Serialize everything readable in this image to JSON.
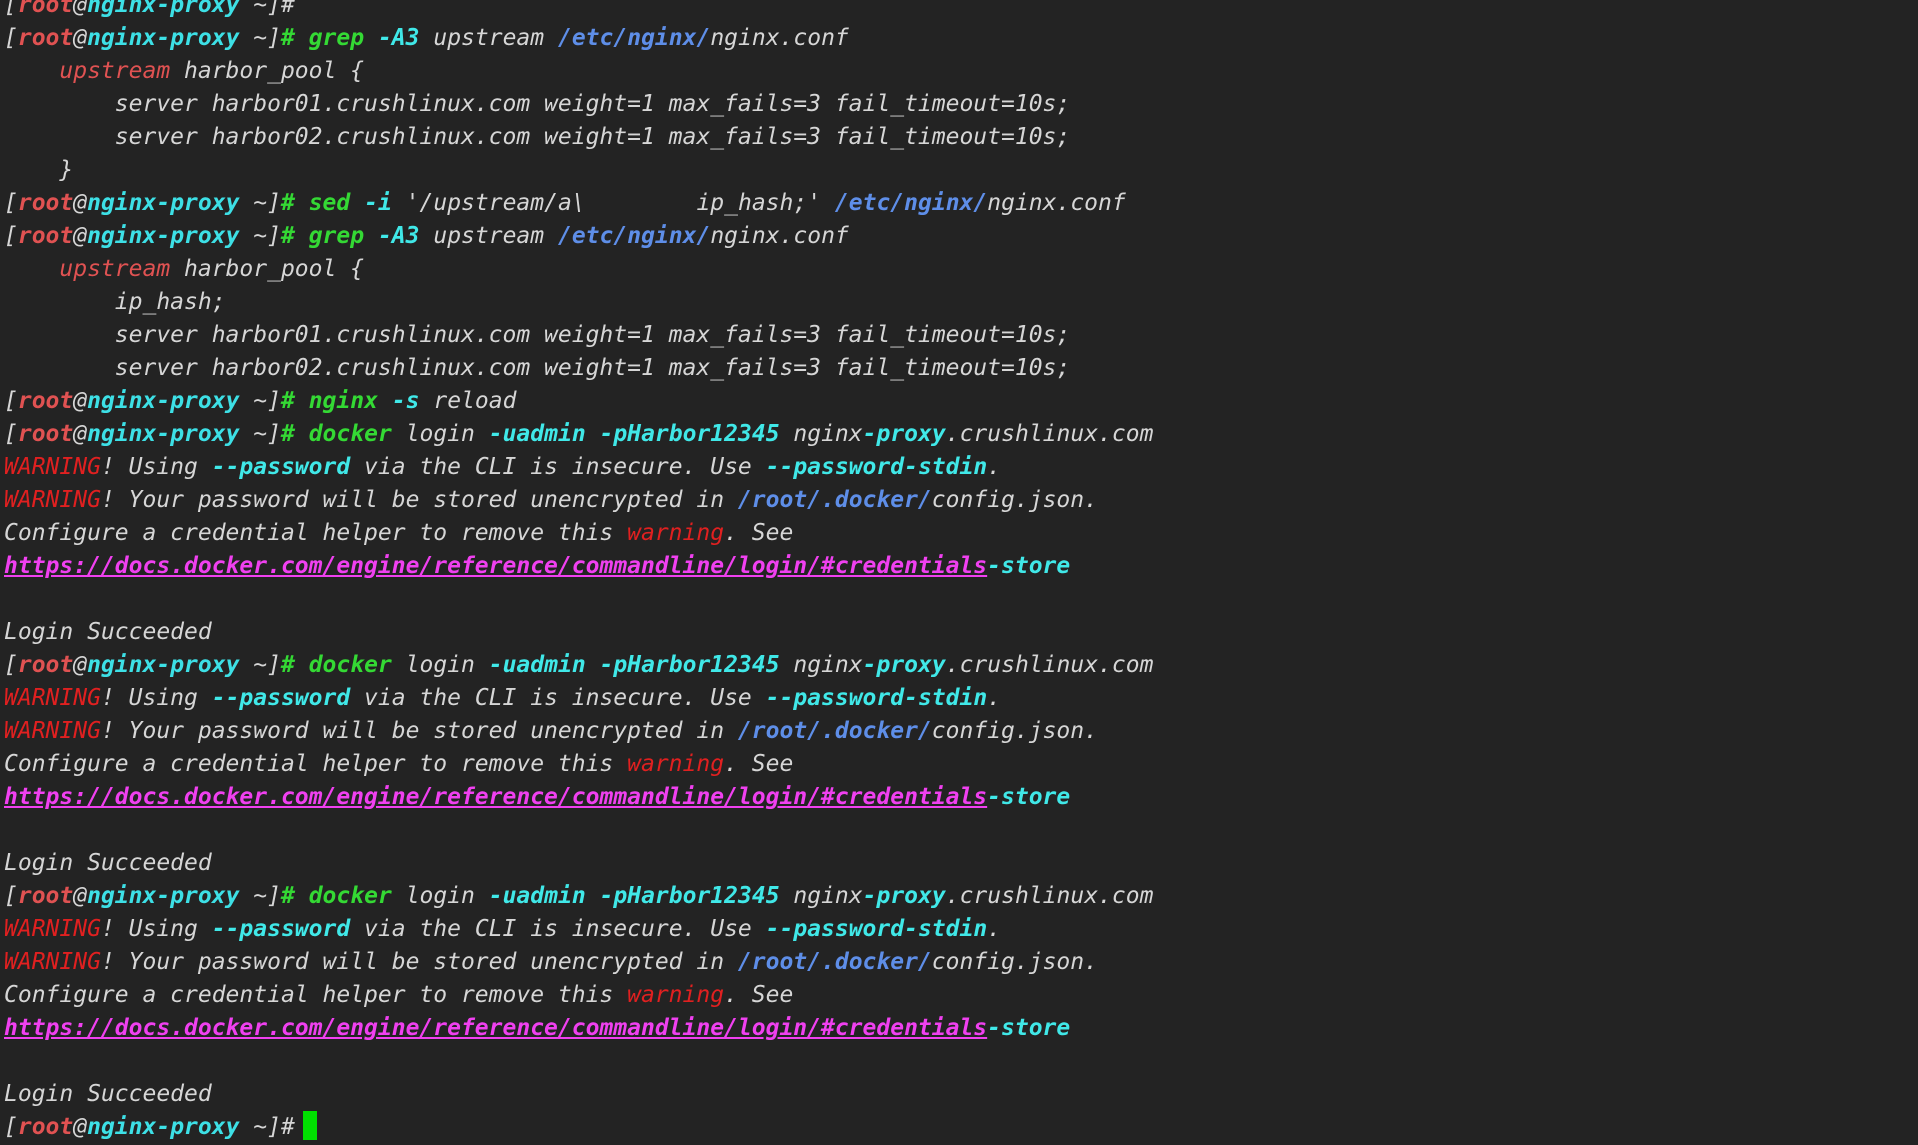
{
  "window": {
    "title": "",
    "background": "#232323"
  },
  "palette": {
    "default": "#d6d6d6",
    "bracket": "#d6d6d6",
    "user": "#e05252",
    "host": "#3de0e6",
    "path": "#5e8ee8",
    "command": "#34d934",
    "option": "#40e8e8",
    "keyword": "#e05252",
    "warning": "#e02020",
    "link": "#f040f0",
    "url_tail": "#40e8e8"
  },
  "terminal": {
    "lines": [
      [
        {
          "t": "[",
          "c": "default"
        },
        {
          "t": "root",
          "c": "user"
        },
        {
          "t": "@",
          "c": "default"
        },
        {
          "t": "nginx",
          "c": "host"
        },
        {
          "t": "-proxy",
          "c": "host"
        },
        {
          "t": " ~]",
          "c": "default"
        },
        {
          "t": "#",
          "c": "default"
        }
      ],
      [
        {
          "t": "[",
          "c": "default"
        },
        {
          "t": "root",
          "c": "user"
        },
        {
          "t": "@",
          "c": "default"
        },
        {
          "t": "nginx",
          "c": "host"
        },
        {
          "t": "-proxy",
          "c": "host"
        },
        {
          "t": " ~]",
          "c": "default"
        },
        {
          "t": "# ",
          "c": "command"
        },
        {
          "t": "grep",
          "c": "command"
        },
        {
          "t": " ",
          "c": "default"
        },
        {
          "t": "-A3",
          "c": "option"
        },
        {
          "t": " upstream ",
          "c": "default"
        },
        {
          "t": "/etc/nginx/",
          "c": "path"
        },
        {
          "t": "nginx.conf",
          "c": "default"
        }
      ],
      [
        {
          "t": "    ",
          "c": "default"
        },
        {
          "t": "upstream",
          "c": "keyword"
        },
        {
          "t": " harbor_pool {",
          "c": "default"
        }
      ],
      [
        {
          "t": "        server harbor01.crushlinux.com weight=1 max_fails=3 fail_timeout=10s;",
          "c": "default"
        }
      ],
      [
        {
          "t": "        server harbor02.crushlinux.com weight=1 max_fails=3 fail_timeout=10s;",
          "c": "default"
        }
      ],
      [
        {
          "t": "    }",
          "c": "default"
        }
      ],
      [
        {
          "t": "[",
          "c": "default"
        },
        {
          "t": "root",
          "c": "user"
        },
        {
          "t": "@",
          "c": "default"
        },
        {
          "t": "nginx",
          "c": "host"
        },
        {
          "t": "-proxy",
          "c": "host"
        },
        {
          "t": " ~]",
          "c": "default"
        },
        {
          "t": "# ",
          "c": "command"
        },
        {
          "t": "sed",
          "c": "command"
        },
        {
          "t": " ",
          "c": "default"
        },
        {
          "t": "-i",
          "c": "option"
        },
        {
          "t": " '/upstream/a\\        ip_hash;' ",
          "c": "default"
        },
        {
          "t": "/etc/nginx/",
          "c": "path"
        },
        {
          "t": "nginx.conf",
          "c": "default"
        }
      ],
      [
        {
          "t": "[",
          "c": "default"
        },
        {
          "t": "root",
          "c": "user"
        },
        {
          "t": "@",
          "c": "default"
        },
        {
          "t": "nginx",
          "c": "host"
        },
        {
          "t": "-proxy",
          "c": "host"
        },
        {
          "t": " ~]",
          "c": "default"
        },
        {
          "t": "# ",
          "c": "command"
        },
        {
          "t": "grep",
          "c": "command"
        },
        {
          "t": " ",
          "c": "default"
        },
        {
          "t": "-A3",
          "c": "option"
        },
        {
          "t": " upstream ",
          "c": "default"
        },
        {
          "t": "/etc/nginx/",
          "c": "path"
        },
        {
          "t": "nginx.conf",
          "c": "default"
        }
      ],
      [
        {
          "t": "    ",
          "c": "default"
        },
        {
          "t": "upstream",
          "c": "keyword"
        },
        {
          "t": " harbor_pool {",
          "c": "default"
        }
      ],
      [
        {
          "t": "        ip_hash;",
          "c": "default"
        }
      ],
      [
        {
          "t": "        server harbor01.crushlinux.com weight=1 max_fails=3 fail_timeout=10s;",
          "c": "default"
        }
      ],
      [
        {
          "t": "        server harbor02.crushlinux.com weight=1 max_fails=3 fail_timeout=10s;",
          "c": "default"
        }
      ],
      [
        {
          "t": "[",
          "c": "default"
        },
        {
          "t": "root",
          "c": "user"
        },
        {
          "t": "@",
          "c": "default"
        },
        {
          "t": "nginx",
          "c": "host"
        },
        {
          "t": "-proxy",
          "c": "host"
        },
        {
          "t": " ~]",
          "c": "default"
        },
        {
          "t": "# ",
          "c": "command"
        },
        {
          "t": "nginx",
          "c": "command"
        },
        {
          "t": " ",
          "c": "default"
        },
        {
          "t": "-s",
          "c": "option"
        },
        {
          "t": " reload",
          "c": "default"
        }
      ],
      [
        {
          "t": "[",
          "c": "default"
        },
        {
          "t": "root",
          "c": "user"
        },
        {
          "t": "@",
          "c": "default"
        },
        {
          "t": "nginx",
          "c": "host"
        },
        {
          "t": "-proxy",
          "c": "host"
        },
        {
          "t": " ~]",
          "c": "default"
        },
        {
          "t": "# ",
          "c": "command"
        },
        {
          "t": "docker",
          "c": "command"
        },
        {
          "t": " login ",
          "c": "default"
        },
        {
          "t": "-uadmin",
          "c": "option"
        },
        {
          "t": " ",
          "c": "default"
        },
        {
          "t": "-pHarbor12345",
          "c": "option"
        },
        {
          "t": " nginx",
          "c": "default"
        },
        {
          "t": "-proxy",
          "c": "option"
        },
        {
          "t": ".crushlinux.com",
          "c": "default"
        }
      ],
      [
        {
          "t": "WARNING",
          "c": "warning"
        },
        {
          "t": "! Using ",
          "c": "default"
        },
        {
          "t": "--password",
          "c": "option"
        },
        {
          "t": " via the CLI is insecure. Use ",
          "c": "default"
        },
        {
          "t": "--password-stdin",
          "c": "option"
        },
        {
          "t": ".",
          "c": "default"
        }
      ],
      [
        {
          "t": "WARNING",
          "c": "warning"
        },
        {
          "t": "! Your password will be stored unencrypted in ",
          "c": "default"
        },
        {
          "t": "/root/.docker/",
          "c": "path"
        },
        {
          "t": "config.json.",
          "c": "default"
        }
      ],
      [
        {
          "t": "Configure a credential helper to remove this ",
          "c": "default"
        },
        {
          "t": "warning",
          "c": "warning"
        },
        {
          "t": ". See",
          "c": "default"
        }
      ],
      [
        {
          "t": "https://docs.docker.com/engine/reference/commandline/login/#credentials",
          "c": "link",
          "u": true
        },
        {
          "t": "-store",
          "c": "url_tail"
        }
      ],
      [
        {
          "t": "",
          "c": "default"
        }
      ],
      [
        {
          "t": "Login Succeeded",
          "c": "default"
        }
      ],
      [
        {
          "t": "[",
          "c": "default"
        },
        {
          "t": "root",
          "c": "user"
        },
        {
          "t": "@",
          "c": "default"
        },
        {
          "t": "nginx",
          "c": "host"
        },
        {
          "t": "-proxy",
          "c": "host"
        },
        {
          "t": " ~]",
          "c": "default"
        },
        {
          "t": "# ",
          "c": "command"
        },
        {
          "t": "docker",
          "c": "command"
        },
        {
          "t": " login ",
          "c": "default"
        },
        {
          "t": "-uadmin",
          "c": "option"
        },
        {
          "t": " ",
          "c": "default"
        },
        {
          "t": "-pHarbor12345",
          "c": "option"
        },
        {
          "t": " nginx",
          "c": "default"
        },
        {
          "t": "-proxy",
          "c": "option"
        },
        {
          "t": ".crushlinux.com",
          "c": "default"
        }
      ],
      [
        {
          "t": "WARNING",
          "c": "warning"
        },
        {
          "t": "! Using ",
          "c": "default"
        },
        {
          "t": "--password",
          "c": "option"
        },
        {
          "t": " via the CLI is insecure. Use ",
          "c": "default"
        },
        {
          "t": "--password-stdin",
          "c": "option"
        },
        {
          "t": ".",
          "c": "default"
        }
      ],
      [
        {
          "t": "WARNING",
          "c": "warning"
        },
        {
          "t": "! Your password will be stored unencrypted in ",
          "c": "default"
        },
        {
          "t": "/root/.docker/",
          "c": "path"
        },
        {
          "t": "config.json.",
          "c": "default"
        }
      ],
      [
        {
          "t": "Configure a credential helper to remove this ",
          "c": "default"
        },
        {
          "t": "warning",
          "c": "warning"
        },
        {
          "t": ". See",
          "c": "default"
        }
      ],
      [
        {
          "t": "https://docs.docker.com/engine/reference/commandline/login/#credentials",
          "c": "link",
          "u": true
        },
        {
          "t": "-store",
          "c": "url_tail"
        }
      ],
      [
        {
          "t": "",
          "c": "default"
        }
      ],
      [
        {
          "t": "Login Succeeded",
          "c": "default"
        }
      ],
      [
        {
          "t": "[",
          "c": "default"
        },
        {
          "t": "root",
          "c": "user"
        },
        {
          "t": "@",
          "c": "default"
        },
        {
          "t": "nginx",
          "c": "host"
        },
        {
          "t": "-proxy",
          "c": "host"
        },
        {
          "t": " ~]",
          "c": "default"
        },
        {
          "t": "# ",
          "c": "command"
        },
        {
          "t": "docker",
          "c": "command"
        },
        {
          "t": " login ",
          "c": "default"
        },
        {
          "t": "-uadmin",
          "c": "option"
        },
        {
          "t": " ",
          "c": "default"
        },
        {
          "t": "-pHarbor12345",
          "c": "option"
        },
        {
          "t": " nginx",
          "c": "default"
        },
        {
          "t": "-proxy",
          "c": "option"
        },
        {
          "t": ".crushlinux.com",
          "c": "default"
        }
      ],
      [
        {
          "t": "WARNING",
          "c": "warning"
        },
        {
          "t": "! Using ",
          "c": "default"
        },
        {
          "t": "--password",
          "c": "option"
        },
        {
          "t": " via the CLI is insecure. Use ",
          "c": "default"
        },
        {
          "t": "--password-stdin",
          "c": "option"
        },
        {
          "t": ".",
          "c": "default"
        }
      ],
      [
        {
          "t": "WARNING",
          "c": "warning"
        },
        {
          "t": "! Your password will be stored unencrypted in ",
          "c": "default"
        },
        {
          "t": "/root/.docker/",
          "c": "path"
        },
        {
          "t": "config.json.",
          "c": "default"
        }
      ],
      [
        {
          "t": "Configure a credential helper to remove this ",
          "c": "default"
        },
        {
          "t": "warning",
          "c": "warning"
        },
        {
          "t": ". See",
          "c": "default"
        }
      ],
      [
        {
          "t": "https://docs.docker.com/engine/reference/commandline/login/#credentials",
          "c": "link",
          "u": true
        },
        {
          "t": "-store",
          "c": "url_tail"
        }
      ],
      [
        {
          "t": "",
          "c": "default"
        }
      ],
      [
        {
          "t": "Login Succeeded",
          "c": "default"
        }
      ],
      [
        {
          "t": "[",
          "c": "default"
        },
        {
          "t": "root",
          "c": "user"
        },
        {
          "t": "@",
          "c": "default"
        },
        {
          "t": "nginx",
          "c": "host"
        },
        {
          "t": "-proxy",
          "c": "host"
        },
        {
          "t": " ~]",
          "c": "default"
        },
        {
          "t": "#",
          "c": "default"
        }
      ]
    ],
    "cursor_visible": true
  }
}
